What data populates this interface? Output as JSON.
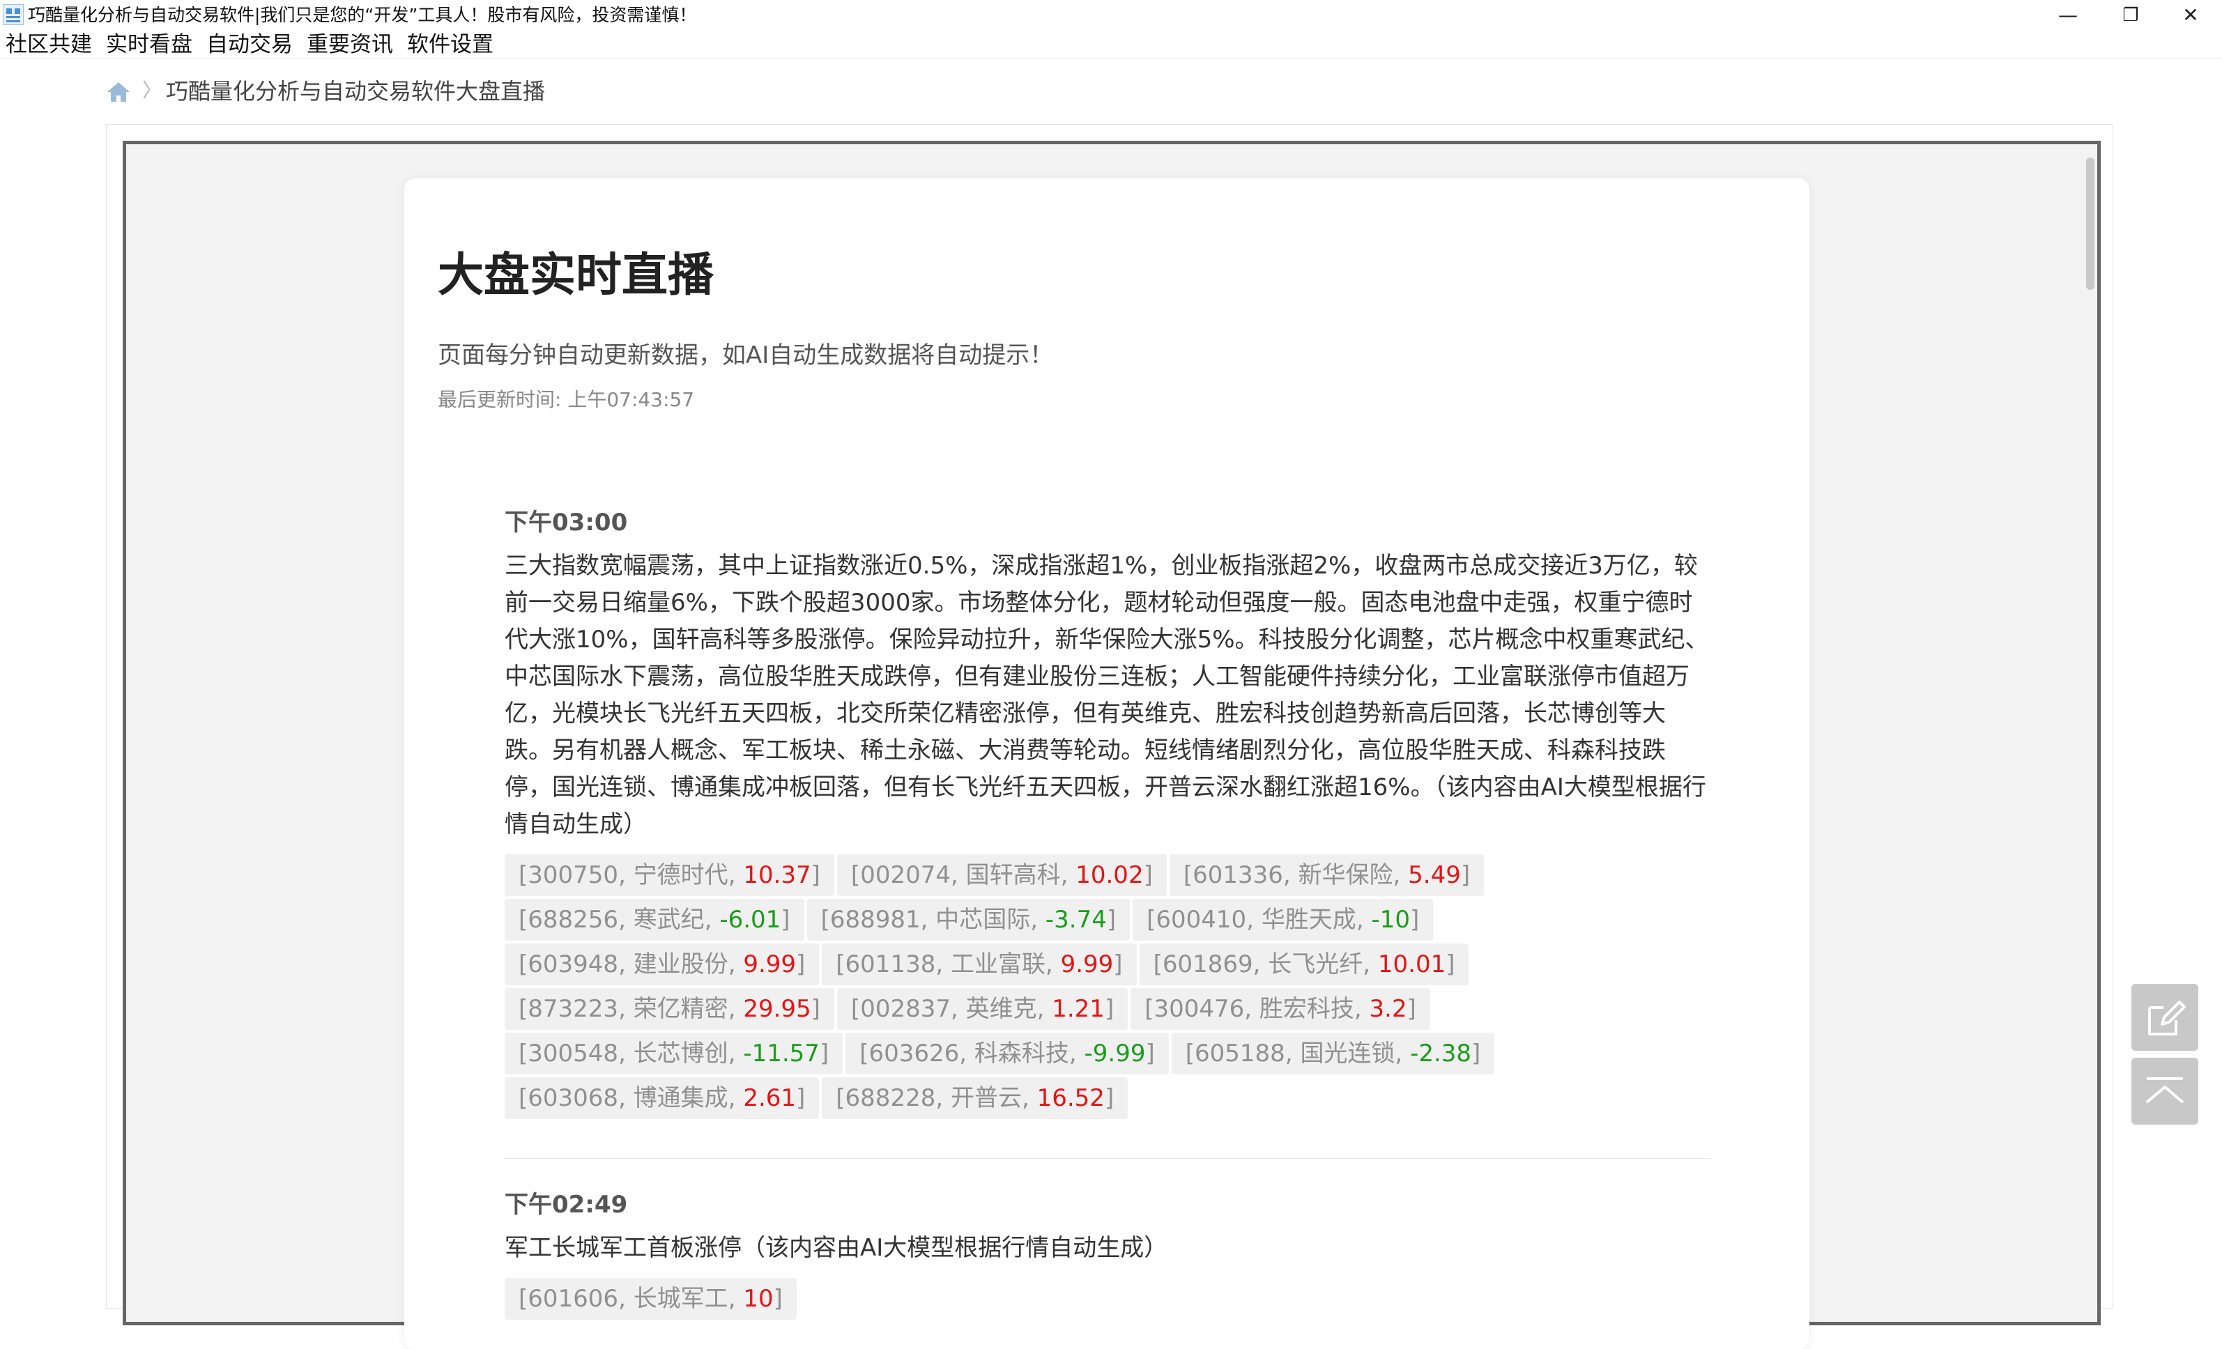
{
  "window": {
    "title": "巧酷量化分析与自动交易软件|我们只是您的“开发”工具人！股市有风险，投资需谨慎！",
    "minimize": "—",
    "restore": "❐",
    "close": "✕"
  },
  "menu": [
    "社区共建",
    "实时看盘",
    "自动交易",
    "重要资讯",
    "软件设置"
  ],
  "breadcrumb": {
    "separator": "〉",
    "current": "巧酷量化分析与自动交易软件大盘直播"
  },
  "page": {
    "title": "大盘实时直播",
    "subtitle": "页面每分钟自动更新数据，如AI自动生成数据将自动提示！",
    "last_update": "最后更新时间: 上午07:43:57"
  },
  "entries": [
    {
      "time": "下午03:00",
      "text": "三大指数宽幅震荡，其中上证指数涨近0.5%，深成指涨超1%，创业板指涨超2%，收盘两市总成交接近3万亿，较前一交易日缩量6%，下跌个股超3000家。市场整体分化，题材轮动但强度一般。固态电池盘中走强，权重宁德时代大涨10%，国轩高科等多股涨停。保险异动拉升，新华保险大涨5%。科技股分化调整，芯片概念中权重寒武纪、中芯国际水下震荡，高位股华胜天成跌停，但有建业股份三连板；人工智能硬件持续分化，工业富联涨停市值超万亿，光模块长飞光纤五天四板，北交所荣亿精密涨停，但有英维克、胜宏科技创趋势新高后回落，长芯博创等大跌。另有机器人概念、军工板块、稀土永磁、大消费等轮动。短线情绪剧烈分化，高位股华胜天成、科森科技跌停，国光连锁、博通集成冲板回落，但有长飞光纤五天四板，开普云深水翻红涨超16%。（该内容由AI大模型根据行情自动生成）",
      "stocks": [
        {
          "code": "300750",
          "name": "宁德时代",
          "change": "10.37",
          "dir": "up"
        },
        {
          "code": "002074",
          "name": "国轩高科",
          "change": "10.02",
          "dir": "up"
        },
        {
          "code": "601336",
          "name": "新华保险",
          "change": "5.49",
          "dir": "up"
        },
        {
          "code": "688256",
          "name": "寒武纪",
          "change": "-6.01",
          "dir": "down"
        },
        {
          "code": "688981",
          "name": "中芯国际",
          "change": "-3.74",
          "dir": "down"
        },
        {
          "code": "600410",
          "name": "华胜天成",
          "change": "-10",
          "dir": "down"
        },
        {
          "code": "603948",
          "name": "建业股份",
          "change": "9.99",
          "dir": "up"
        },
        {
          "code": "601138",
          "name": "工业富联",
          "change": "9.99",
          "dir": "up"
        },
        {
          "code": "601869",
          "name": "长飞光纤",
          "change": "10.01",
          "dir": "up"
        },
        {
          "code": "873223",
          "name": "荣亿精密",
          "change": "29.95",
          "dir": "up"
        },
        {
          "code": "002837",
          "name": "英维克",
          "change": "1.21",
          "dir": "up"
        },
        {
          "code": "300476",
          "name": "胜宏科技",
          "change": "3.2",
          "dir": "up"
        },
        {
          "code": "300548",
          "name": "长芯博创",
          "change": "-11.57",
          "dir": "down"
        },
        {
          "code": "603626",
          "name": "科森科技",
          "change": "-9.99",
          "dir": "down"
        },
        {
          "code": "605188",
          "name": "国光连锁",
          "change": "-2.38",
          "dir": "down"
        },
        {
          "code": "603068",
          "name": "博通集成",
          "change": "2.61",
          "dir": "up"
        },
        {
          "code": "688228",
          "name": "开普云",
          "change": "16.52",
          "dir": "up"
        }
      ]
    },
    {
      "time": "下午02:49",
      "text": "军工长城军工首板涨停（该内容由AI大模型根据行情自动生成）",
      "stocks": [
        {
          "code": "601606",
          "name": "长城军工",
          "change": "10",
          "dir": "up"
        }
      ]
    }
  ],
  "floating": {
    "edit_icon": "edit-icon",
    "top_icon": "back-to-top-icon"
  },
  "colors": {
    "up": "#e41414",
    "down": "#1a9d1a",
    "tag_bg": "#f0f0f0",
    "tag_text": "#909090"
  }
}
